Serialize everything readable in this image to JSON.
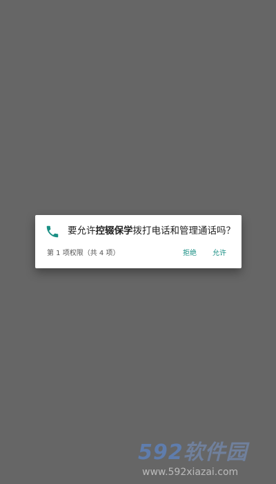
{
  "colors": {
    "scrim": "#666666",
    "dialog_bg": "#ffffff",
    "accent": "#1a8f84",
    "text_primary": "#222222",
    "text_secondary": "#555555"
  },
  "dialog": {
    "icon": "phone-icon",
    "message_prefix": "要允许",
    "app_name": "控辍保学",
    "message_suffix": "拨打电话和管理通话吗？",
    "counter": "第 1 项权限（共 4 项）",
    "deny_label": "拒绝",
    "allow_label": "允许"
  },
  "watermark": {
    "logo_number": "592",
    "logo_text": "软件园",
    "url": "www.592xiazai.com"
  }
}
